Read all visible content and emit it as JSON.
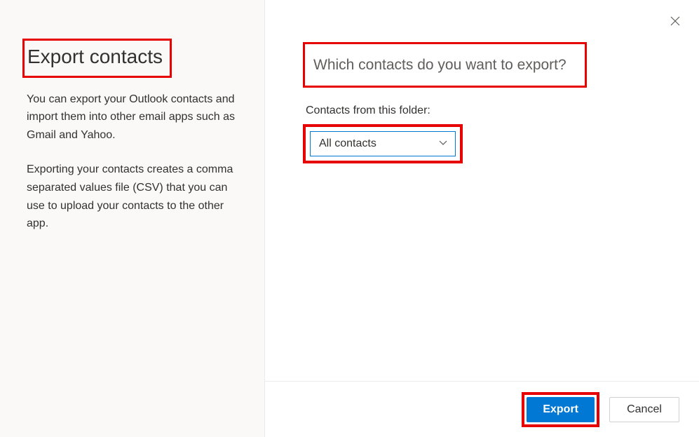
{
  "left": {
    "title": "Export contacts",
    "desc1": "You can export your Outlook contacts and import them into other email apps such as Gmail and Yahoo.",
    "desc2": "Exporting your contacts creates a comma separated values file (CSV) that you can use to upload your contacts to the other app."
  },
  "right": {
    "subtitle": "Which contacts do you want to export?",
    "folder_label": "Contacts from this folder:",
    "dropdown_value": "All contacts"
  },
  "footer": {
    "export_label": "Export",
    "cancel_label": "Cancel"
  }
}
